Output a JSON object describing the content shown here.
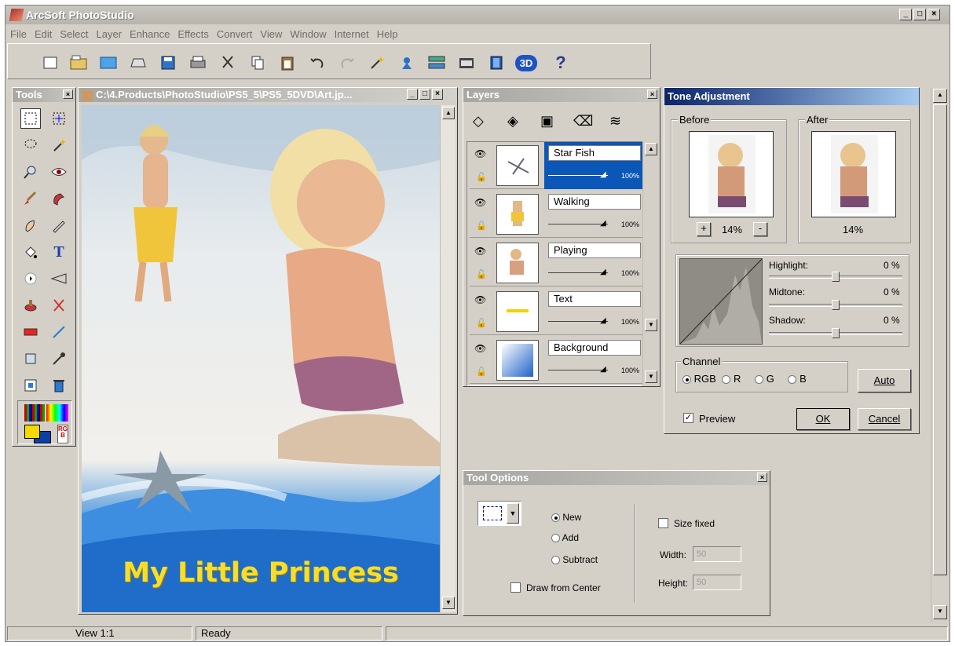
{
  "app": {
    "title": "ArcSoft PhotoStudio",
    "window_buttons": [
      "_",
      "□",
      "×"
    ]
  },
  "menu": [
    "File",
    "Edit",
    "Select",
    "Layer",
    "Enhance",
    "Effects",
    "Convert",
    "View",
    "Window",
    "Internet",
    "Help"
  ],
  "toolbar_icons": [
    "new-file-icon",
    "open-folder-icon",
    "acquire-icon",
    "scanner-icon",
    "save-icon",
    "print-icon",
    "cut-icon",
    "copy-icon",
    "paste-icon",
    "undo-icon",
    "redo-icon",
    "magic-icon",
    "wizard-icon",
    "album-icon",
    "slideshow-icon",
    "book-icon",
    "3d-icon",
    "help-icon"
  ],
  "toolbar_3d": "3D",
  "toolbar_help": "?",
  "tools_panel": {
    "title": "Tools",
    "close": "×",
    "text_tool": "T",
    "rgb": "RGB"
  },
  "doc": {
    "title": "C:\\4.Products\\PhotoStudio\\PS5_5\\PS5_5DVD\\Art.jp...",
    "caption": "My Little Princess",
    "win_buttons": [
      "_",
      "□",
      "×"
    ]
  },
  "layers_panel": {
    "title": "Layers",
    "close": "×",
    "layers": [
      {
        "name": "Star Fish",
        "opacity": "100%"
      },
      {
        "name": "Walking",
        "opacity": "100%"
      },
      {
        "name": "Playing",
        "opacity": "100%"
      },
      {
        "name": "Text",
        "opacity": "100%"
      },
      {
        "name": "Background",
        "opacity": "100%"
      }
    ]
  },
  "tone": {
    "title": "Tone Adjustment",
    "before_label": "Before",
    "after_label": "After",
    "before_zoom": "14%",
    "after_zoom": "14%",
    "plus": "+",
    "minus": "-",
    "highlight_label": "Highlight:",
    "highlight_value": "0 %",
    "midtone_label": "Midtone:",
    "midtone_value": "0 %",
    "shadow_label": "Shadow:",
    "shadow_value": "0 %",
    "channel_label": "Channel",
    "channels": [
      "RGB",
      "R",
      "G",
      "B"
    ],
    "auto": "Auto",
    "preview": "Preview",
    "ok": "OK",
    "cancel": "Cancel"
  },
  "tool_options": {
    "title": "Tool Options",
    "close": "×",
    "modes": [
      "New",
      "Add",
      "Subtract"
    ],
    "draw_from_center": "Draw from Center",
    "size_fixed": "Size fixed",
    "width_label": "Width:",
    "width_value": "50",
    "height_label": "Height:",
    "height_value": "50"
  },
  "status": {
    "view": "View 1:1",
    "state": "Ready"
  }
}
